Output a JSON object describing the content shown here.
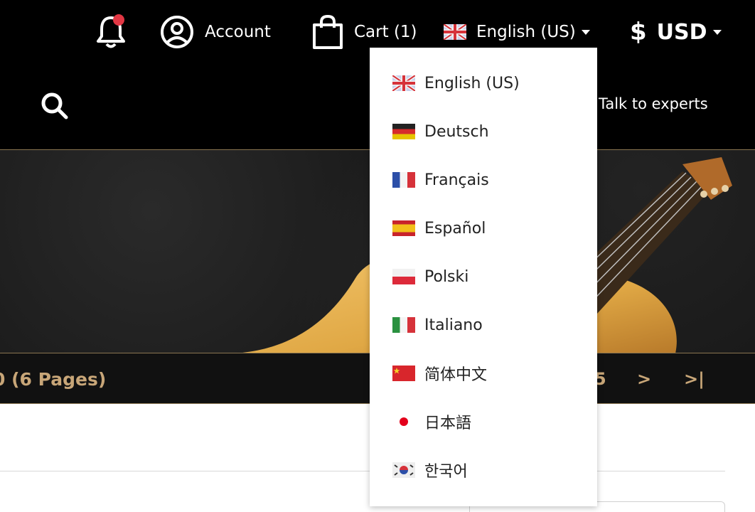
{
  "header": {
    "account_label": "Account",
    "cart_label": "Cart (1)",
    "language_label": "English (US)",
    "currency_symbol": "$",
    "currency_label": "USD",
    "talk_label": "Talk to experts"
  },
  "pagination": {
    "pages_text": "0 (6 Pages)",
    "last_number": "5",
    "next": ">",
    "last": ">|"
  },
  "language_menu": {
    "items": [
      {
        "label": "English (US)",
        "flag": "uk-flag-icon"
      },
      {
        "label": "Deutsch",
        "flag": "germany-flag-icon"
      },
      {
        "label": "Français",
        "flag": "france-flag-icon"
      },
      {
        "label": "Español",
        "flag": "spain-flag-icon"
      },
      {
        "label": "Polski",
        "flag": "poland-flag-icon"
      },
      {
        "label": "Italiano",
        "flag": "italy-flag-icon"
      },
      {
        "label": "简体中文",
        "flag": "china-flag-icon"
      },
      {
        "label": "日本語",
        "flag": "japan-flag-icon"
      },
      {
        "label": "한국어",
        "flag": "korea-flag-icon"
      }
    ]
  },
  "colors": {
    "header_bg": "#000000",
    "accent_gold": "#c8a678",
    "notification_dot": "#e23744"
  }
}
